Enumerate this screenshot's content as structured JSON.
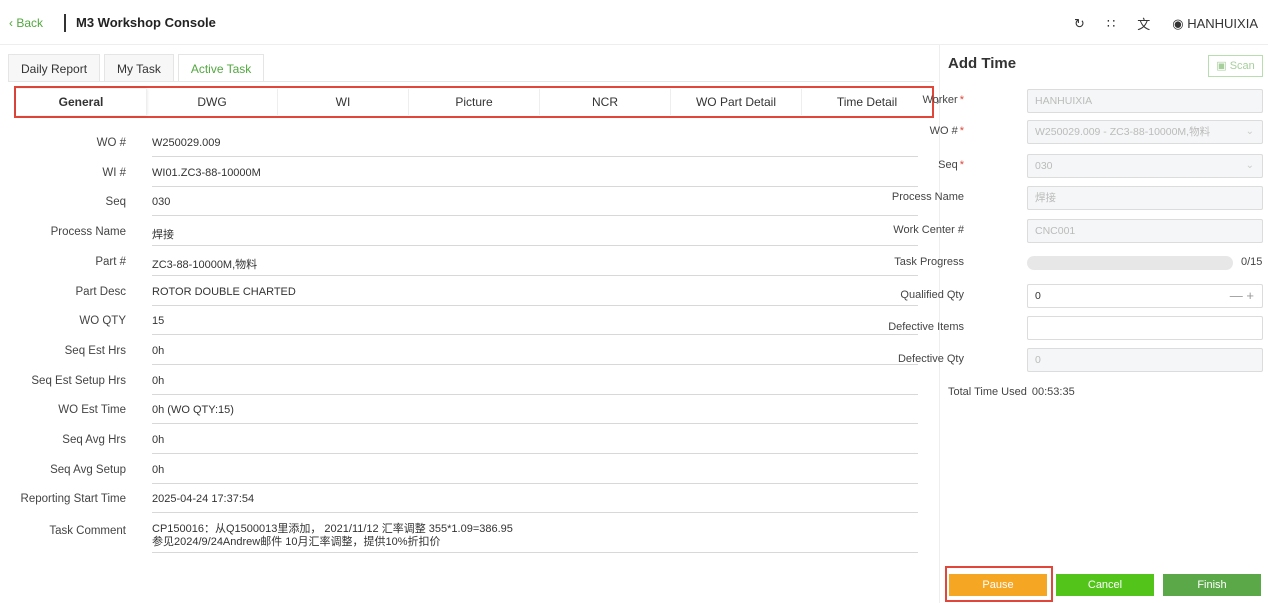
{
  "header": {
    "back_label": "Back",
    "title": "M3 Workshop Console",
    "user": "HANHUIXIA",
    "icons": [
      "refresh-icon",
      "fullscreen-icon",
      "translate-icon",
      "user-icon"
    ]
  },
  "top_tabs": [
    "Daily Report",
    "My Task",
    "Active Task"
  ],
  "sub_tabs": [
    "General",
    "DWG",
    "WI",
    "Picture",
    "NCR",
    "WO Part Detail",
    "Time Detail"
  ],
  "general": {
    "fields": [
      {
        "label": "WO #",
        "value": "W250029.009"
      },
      {
        "label": "WI #",
        "value": "WI01.ZC3-88-10000M"
      },
      {
        "label": "Seq",
        "value": "030"
      },
      {
        "label": "Process Name",
        "value": "焊接"
      },
      {
        "label": "Part #",
        "value": "ZC3-88-10000M,物料"
      },
      {
        "label": "Part Desc",
        "value": "ROTOR DOUBLE CHARTED"
      },
      {
        "label": "WO QTY",
        "value": "15"
      },
      {
        "label": "Seq Est Hrs",
        "value": "0h"
      },
      {
        "label": "Seq Est Setup Hrs",
        "value": "0h"
      },
      {
        "label": "WO Est Time",
        "value": "0h (WO QTY:15)"
      },
      {
        "label": "Seq Avg Hrs",
        "value": "0h"
      },
      {
        "label": "Seq Avg Setup",
        "value": "0h"
      },
      {
        "label": "Reporting Start Time",
        "value": "2025-04-24 17:37:54"
      }
    ],
    "task_comment_label": "Task Comment",
    "task_comment_line1": "CP150016：从Q1500013里添加， 2021/11/12 汇率调整 355*1.09=386.95",
    "task_comment_line2": "参见2024/9/24Andrew邮件 10月汇率调整，提供10%折扣价"
  },
  "add_time": {
    "title": "Add Time",
    "scan_label": "Scan",
    "worker_label": "Worker",
    "worker_value": "HANHUIXIA",
    "wo_label": "WO #",
    "wo_value": "W250029.009 - ZC3-88-10000M,物料",
    "seq_label": "Seq",
    "seq_value": "030",
    "process_label": "Process Name",
    "process_value": "焊接",
    "workcenter_label": "Work Center #",
    "workcenter_value": "CNC001",
    "progress_label": "Task Progress",
    "progress_text": "0/15",
    "progress_fraction": 0,
    "qualified_label": "Qualified Qty",
    "qualified_value": "0",
    "defective_items_label": "Defective Items",
    "defective_qty_label": "Defective Qty",
    "defective_qty_value": "0",
    "total_time_label": "Total Time Used",
    "total_time_value": "00:53:35"
  },
  "buttons": {
    "pause": "Pause",
    "cancel": "Cancel",
    "finish": "Finish"
  },
  "colors": {
    "accent": "#52a83f",
    "highlight": "#e0463a",
    "pause": "#f5a623",
    "cancel": "#52c41a",
    "finish": "#5aa847"
  }
}
